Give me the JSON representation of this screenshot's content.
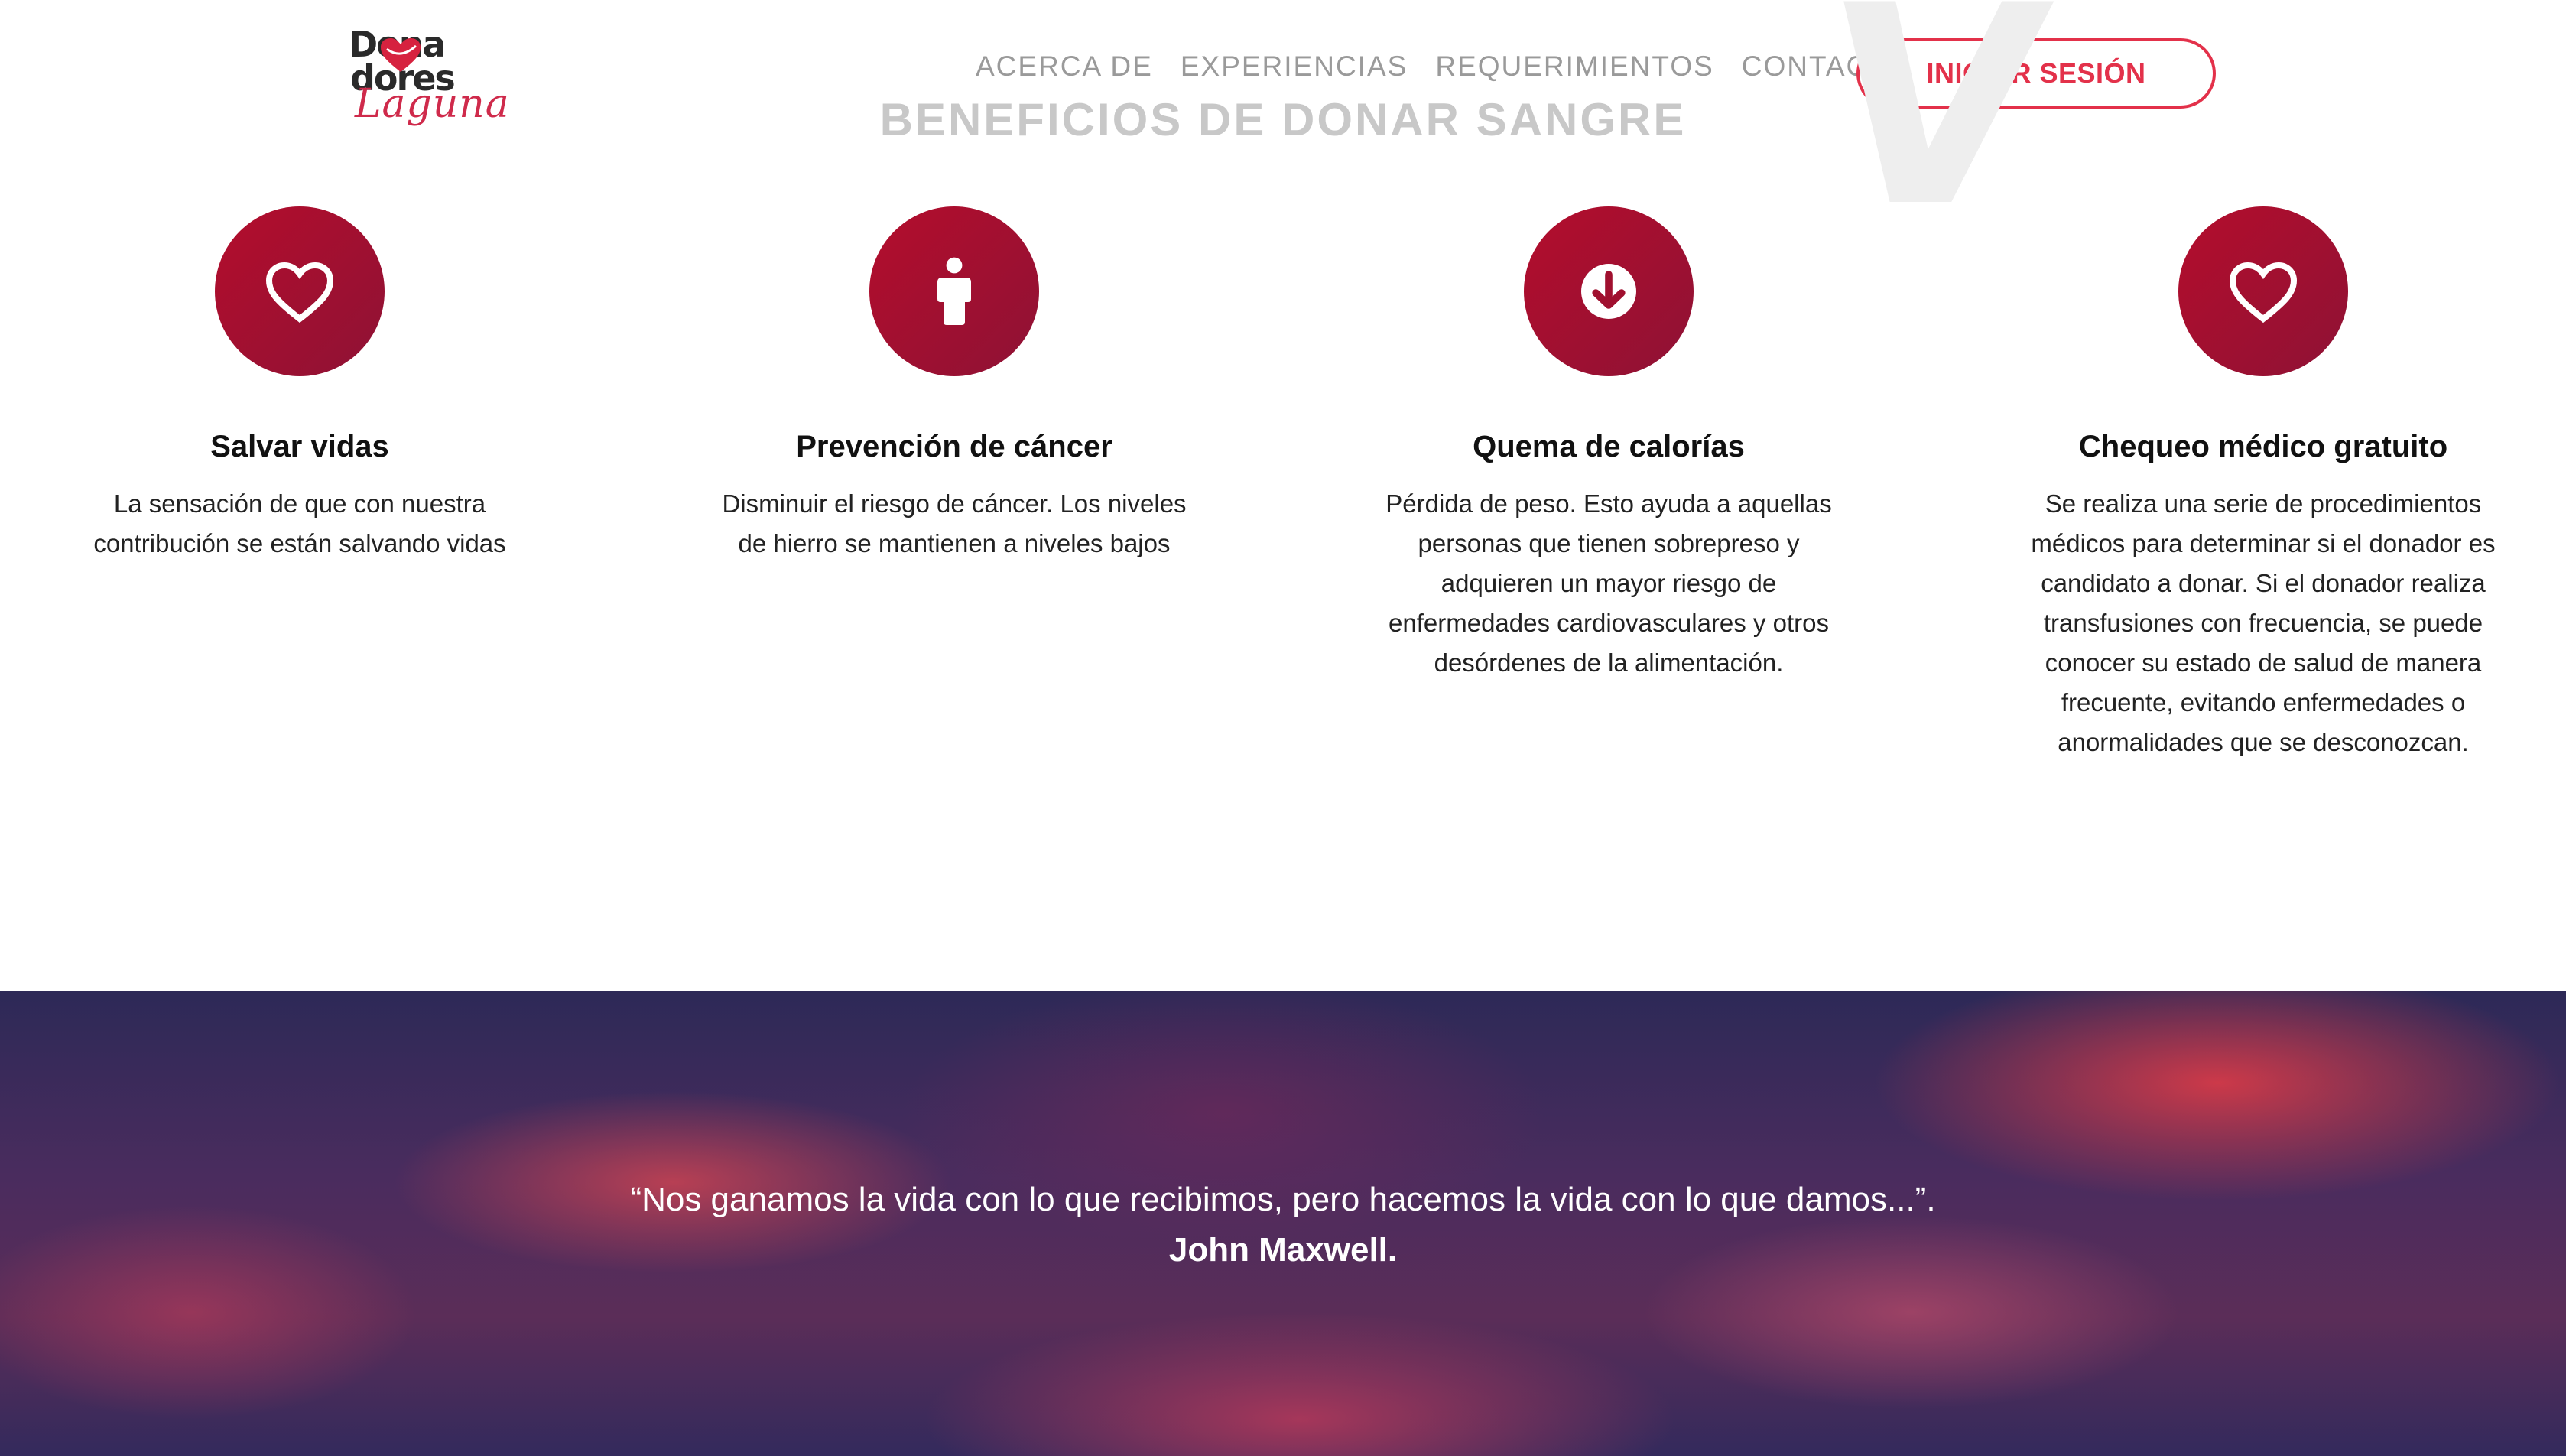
{
  "header": {
    "logo": {
      "line1": "Dona",
      "line2": "dores",
      "script": "Laguna"
    },
    "nav": [
      "ACERCA DE",
      "EXPERIENCIAS",
      "REQUERIMIENTOS",
      "CONTACTO"
    ],
    "login_label": "INICIAR SESIÓN"
  },
  "section": {
    "title": "BENEFICIOS DE DONAR SANGRE",
    "watermark": "V"
  },
  "benefits": [
    {
      "icon": "heart-icon",
      "title": "Salvar vidas",
      "text": "La sensación de que con nuestra contribución se están salvando vidas"
    },
    {
      "icon": "person-icon",
      "title": "Prevención de cáncer",
      "text": "Disminuir el riesgo de cáncer. Los niveles de hierro se mantienen a niveles bajos"
    },
    {
      "icon": "arrow-down-circle-icon",
      "title": "Quema de calorías",
      "text": "Pérdida de peso. Esto ayuda a aquellas personas que tienen sobrepreso y adquieren un mayor riesgo de enfermedades cardiovasculares y otros desórdenes de la alimentación."
    },
    {
      "icon": "heart-icon",
      "title": "Chequeo médico gratuito",
      "text": "Se realiza una serie de procedimientos médicos para determinar si el donador es candidato a donar. Si el donador realiza transfusiones con frecuencia, se puede conocer su estado de salud de manera frecuente, evitando enfermedades o anormalidades que se desconozcan."
    }
  ],
  "quote": {
    "text": "“Nos ganamos la vida con lo que recibimos, pero hacemos la vida con lo que damos...”.",
    "author": "John Maxwell."
  },
  "colors": {
    "accent": "#e3314a",
    "circle": "#a0102f",
    "nav": "#9a9a9a"
  }
}
